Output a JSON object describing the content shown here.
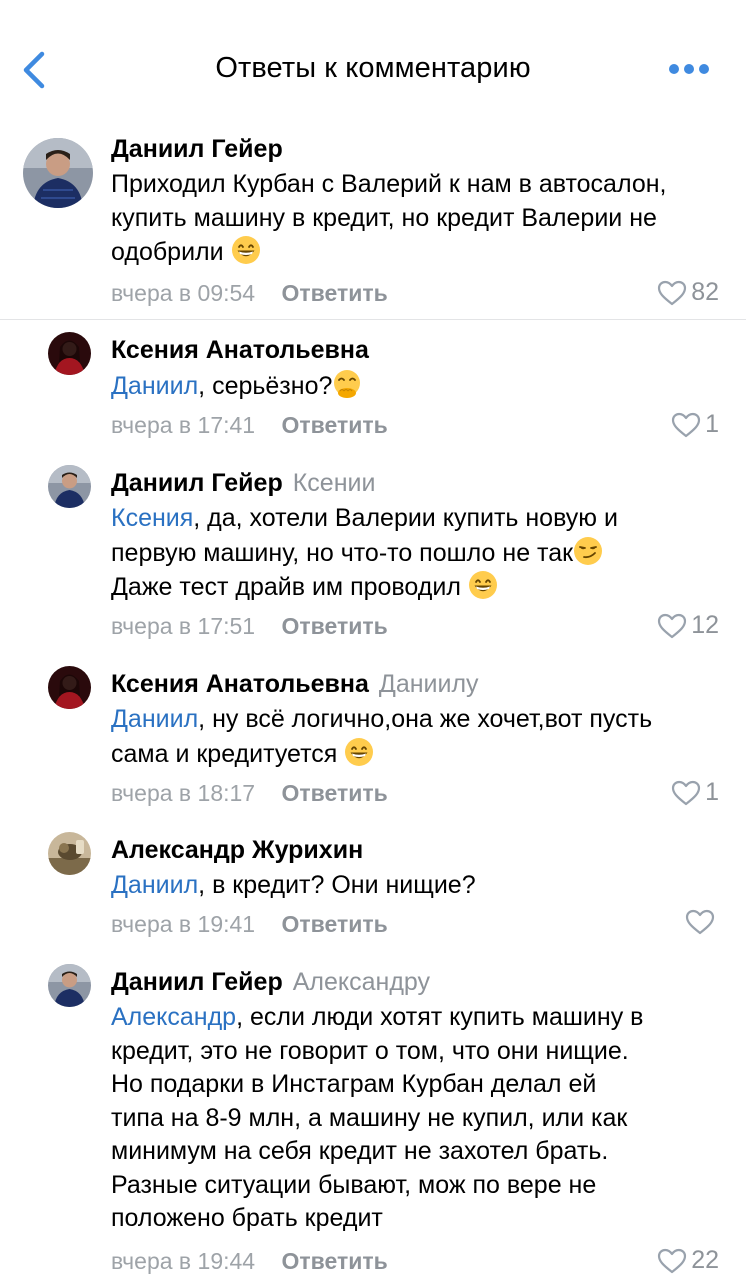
{
  "header": {
    "title": "Ответы к комментарию",
    "back_icon": "chevron-left-icon",
    "more_icon": "more-dots-icon",
    "accent": "#3f8ae0"
  },
  "colors": {
    "mention": "#2a71c2",
    "meta": "#9ea3a8",
    "reply": "#8e9399"
  },
  "comments": [
    {
      "author": "Даниил Гейер",
      "reply_to": "",
      "mention": "",
      "text": "Приходил Курбан с Валерий к нам в автосалон, купить машину в кредит, но кредит Валерии не одобрили",
      "emoji": "grin-emoji",
      "time": "вчера в 09:54",
      "reply_label": "Ответить",
      "likes": "82"
    },
    {
      "author": "Ксения Анатольевна",
      "reply_to": "",
      "mention": "Даниил",
      "text": ", серьёзно?",
      "emoji": "hand-over-mouth-emoji",
      "time": "вчера в 17:41",
      "reply_label": "Ответить",
      "likes": "1"
    },
    {
      "author": "Даниил Гейер",
      "reply_to": "Ксении",
      "mention": "Ксения",
      "text_lines": [
        ", да, хотели Валерии купить новую и",
        "первую машину, но что-то пошло не так",
        "Даже тест драйв им проводил"
      ],
      "emoji": "smirk-emoji",
      "emoji2": "grin-emoji",
      "time": "вчера в 17:51",
      "reply_label": "Ответить",
      "likes": "12"
    },
    {
      "author": "Ксения Анатольевна",
      "reply_to": "Даниилу",
      "mention": "Даниил",
      "text_lines": [
        ", ну всё логично,она же хочет,вот пусть",
        "сама и кредитуется"
      ],
      "emoji": "grin-emoji",
      "time": "вчера в 18:17",
      "reply_label": "Ответить",
      "likes": "1"
    },
    {
      "author": "Александр Журихин",
      "reply_to": "",
      "mention": "Даниил",
      "text": ", в кредит? Они нищие?",
      "time": "вчера в 19:41",
      "reply_label": "Ответить",
      "likes": ""
    },
    {
      "author": "Даниил Гейер",
      "reply_to": "Александру",
      "mention": "Александр",
      "text_lines": [
        ", если люди хотят купить машину в",
        "кредит, это не говорит о том, что они нищие.",
        "Но подарки в Инстаграм Курбан делал ей",
        "типа на 8-9 млн, а машину не купил, или как",
        "минимум на себя кредит не захотел брать.",
        "Разные ситуации бывают, мож по вере не",
        "положено брать кредит"
      ],
      "time": "вчера в 19:44",
      "reply_label": "Ответить",
      "likes": "22"
    }
  ]
}
